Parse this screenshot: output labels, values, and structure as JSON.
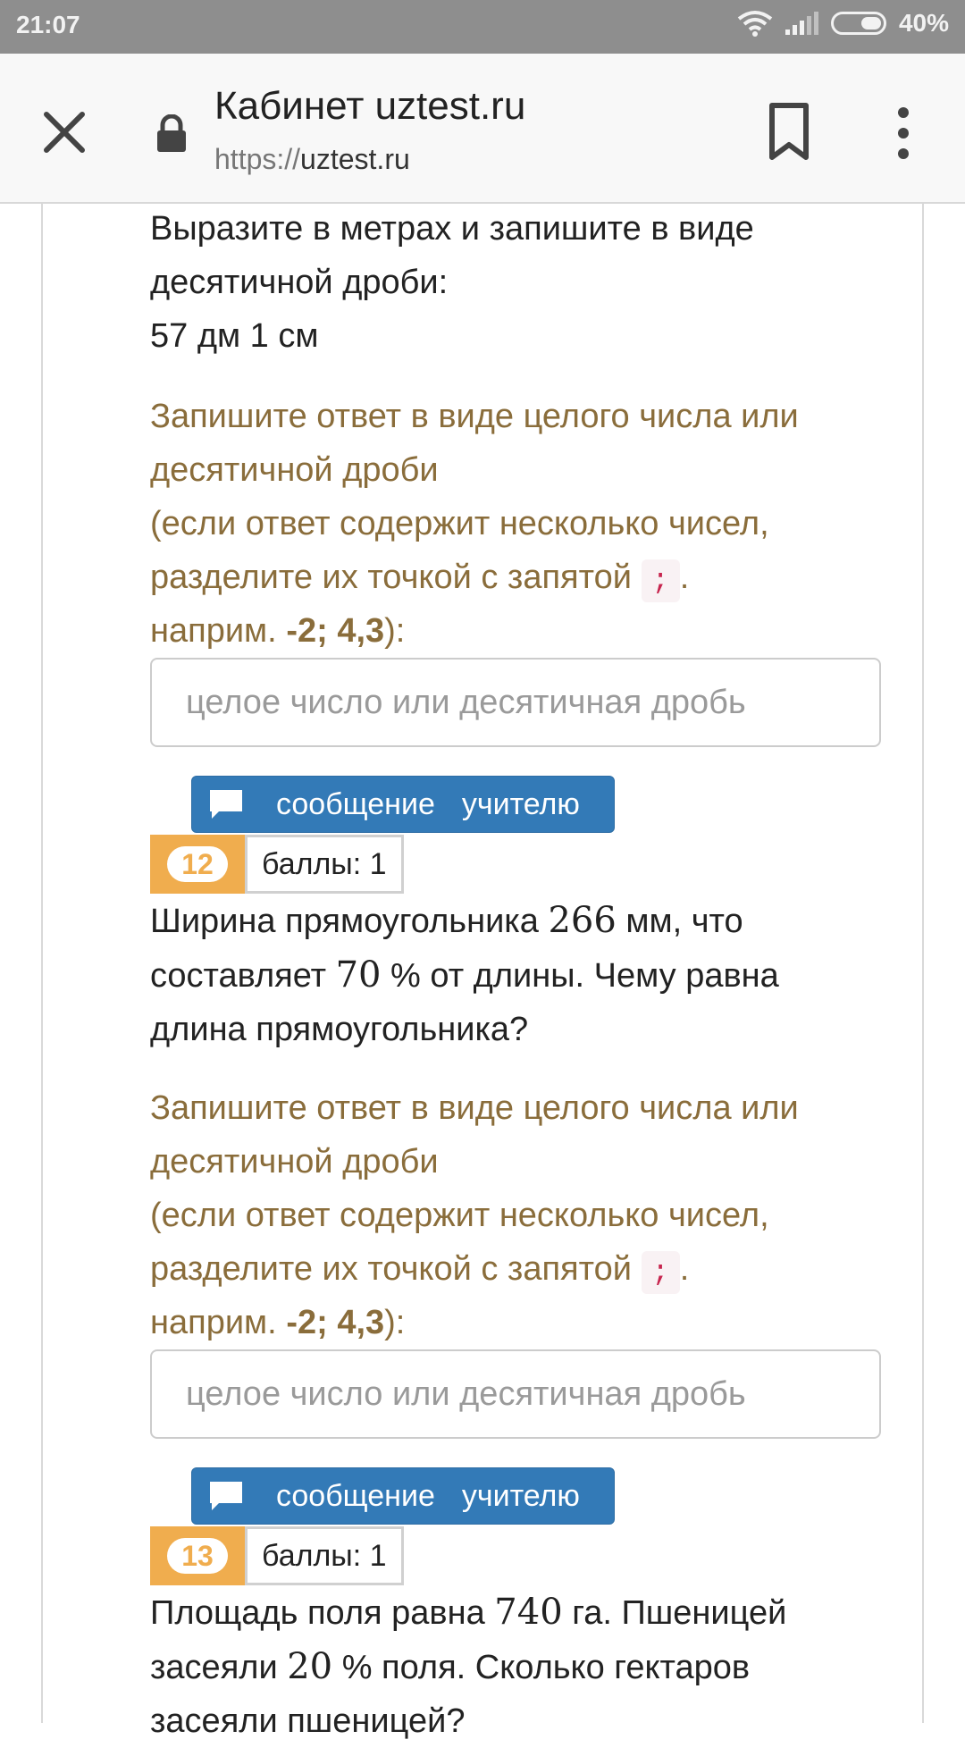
{
  "status": {
    "time": "21:07",
    "battery": "40%"
  },
  "browser": {
    "title": "Кабинет uztest.ru",
    "url_scheme": "https://",
    "url_host": "uztest.ru"
  },
  "q11": {
    "text_line1": "Выразите в метрах и запишите в виде",
    "text_line2": "десятичной дроби:",
    "text_line3": "57 дм 1 см"
  },
  "hint": {
    "line1": "Запишите ответ в виде целого числа или",
    "line2": "десятичной дроби",
    "line3": "(если ответ содержит несколько чисел,",
    "line4": "разделите их точкой с запятой",
    "separator": ";",
    "dot": ".",
    "example_prefix": "наприм.",
    "example": "-2; 4,3",
    "example_suffix": "):"
  },
  "answer": {
    "placeholder": "целое число или десятичная дробь"
  },
  "message_button": {
    "word1": "сообщение",
    "word2": "учителю"
  },
  "q12": {
    "number": "12",
    "points": "баллы: 1",
    "text_a": "Ширина прямоугольника",
    "value1": "266",
    "text_b": "мм, что",
    "text_c": "составляет",
    "value2": "70",
    "text_d": "% от длины. Чему равна",
    "text_e": "длина прямоугольника?"
  },
  "q13": {
    "number": "13",
    "points": "баллы: 1",
    "text_a": "Площадь поля равна",
    "value1": "740",
    "text_b": "га. Пшеницей",
    "text_c": "засеяли",
    "value2": "20",
    "text_d": "% поля. Сколько гектаров",
    "text_e": "засеяли пшеницей?"
  }
}
